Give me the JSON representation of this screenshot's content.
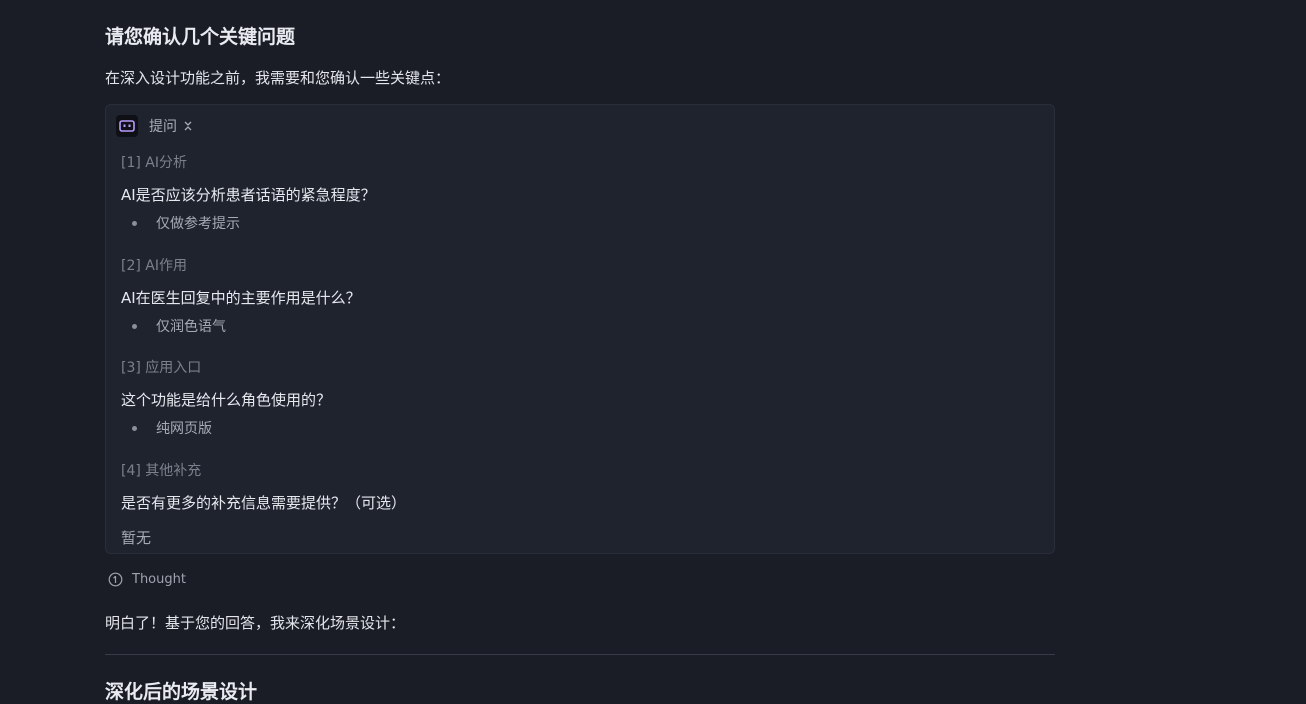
{
  "message": {
    "heading": "请您确认几个关键问题",
    "intro": "在深入设计功能之前，我需要和您确认一些关键点：",
    "card": {
      "icon": "bot-icon",
      "title": "提问",
      "toggle_icon": "chevron-collapse-icon",
      "questions": [
        {
          "tag": "[1] AI分析",
          "question": "AI是否应该分析患者话语的紧急程度？",
          "answer": "仅做参考提示"
        },
        {
          "tag": "[2] AI作用",
          "question": "AI在医生回复中的主要作用是什么？",
          "answer": "仅润色语气"
        },
        {
          "tag": "[3] 应用入口",
          "question": "这个功能是给什么角色使用的？",
          "answer": "纯网页版"
        },
        {
          "tag": "[4] 其他补充",
          "question": "是否有更多的补充信息需要提供？（可选）",
          "answer": "暂无"
        }
      ]
    },
    "thought_label": "Thought",
    "thought_icon": "info-circle-icon",
    "reply": "明白了！基于您的回答，我来深化场景设计：",
    "section_heading": "深化后的场景设计"
  }
}
